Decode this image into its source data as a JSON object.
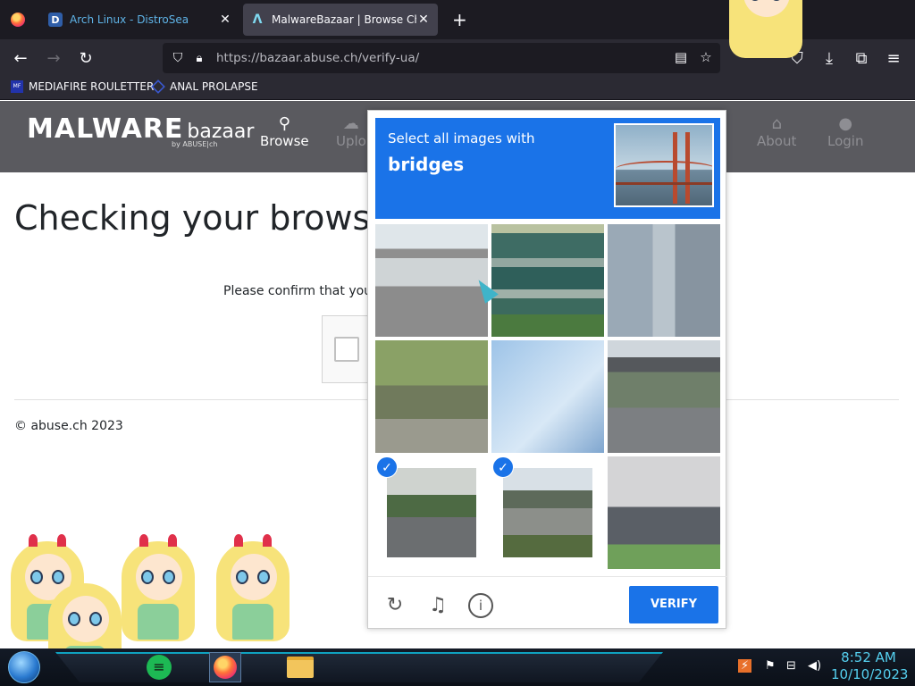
{
  "browser": {
    "tabs": [
      {
        "icon": "D",
        "title": "Arch Linux - DistroSea",
        "close": "✕"
      },
      {
        "icon": "Λ",
        "title": "MalwareBazaar | Browse Check",
        "close": "✕"
      }
    ],
    "new_tab": "+",
    "url": "https://bazaar.abuse.ch/verify-ua/",
    "bookmarks": [
      {
        "label": "MEDIAFIRE ROULETTER",
        "icon_text": "MF"
      },
      {
        "label": "ANAL PROLAPSE"
      }
    ]
  },
  "site": {
    "brand_main": "MALWARE",
    "brand_sub": "bazaar",
    "brand_by": "by ABUSE|ch",
    "nav": [
      {
        "label": "Browse",
        "icon": "search-icon"
      },
      {
        "label": "Uplo",
        "icon": "upload-icon"
      },
      {
        "label": "About",
        "icon": "building-icon"
      },
      {
        "label": "Login",
        "icon": "user-icon"
      }
    ],
    "page_title": "Checking your browser",
    "confirm_text": "Please confirm that you",
    "footer": "© abuse.ch 2023"
  },
  "captcha": {
    "instruction": "Select all images with",
    "target": "bridges",
    "verify_label": "VERIFY",
    "selected_tiles": [
      6,
      7
    ],
    "check_mark": "✓"
  },
  "taskbar": {
    "time": "8:52 AM",
    "date": "10/10/2023"
  },
  "colors": {
    "captcha_blue": "#1a73e8",
    "site_nav": "#5a5a5f",
    "browser_dark": "#1c1b22",
    "clock": "#55d0ef"
  }
}
